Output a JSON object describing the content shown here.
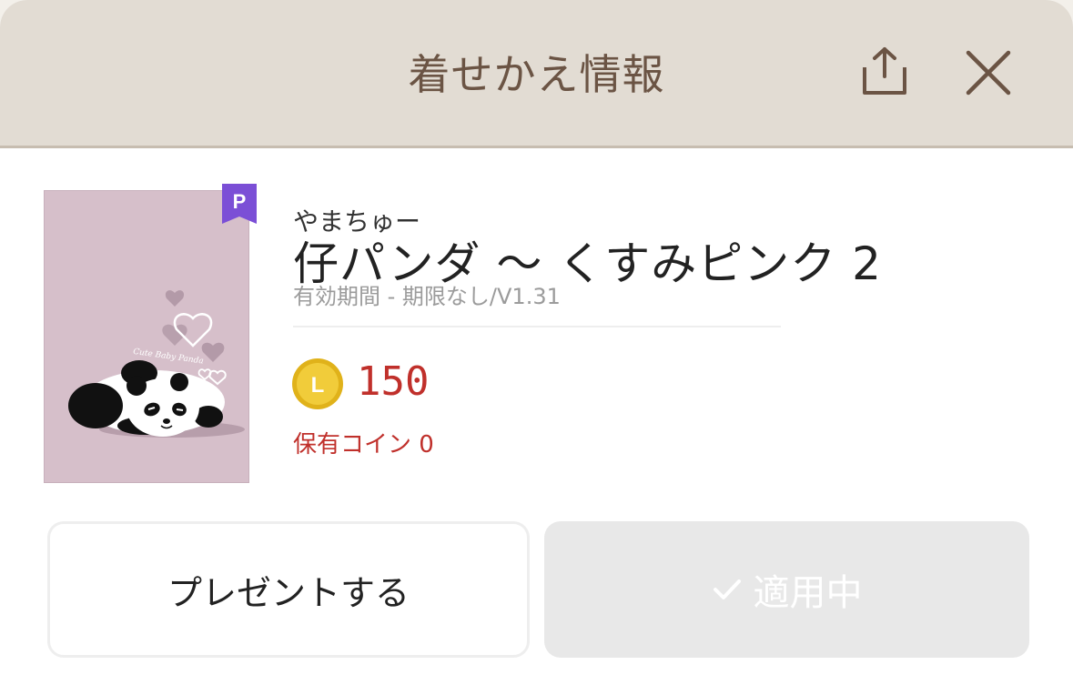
{
  "header": {
    "title": "着せかえ情報",
    "share_icon": "share-icon",
    "close_icon": "close-icon"
  },
  "theme": {
    "premium_badge": "P",
    "artist": "やまちゅー",
    "title": "仔パンダ 〜 くすみピンク 2",
    "meta": "有効期間 - 期限なし/V1.31",
    "thumbnail_caption": "Cute Baby Panda",
    "thumbnail_bg": "#d6bfca"
  },
  "price": {
    "coin_letter": "L",
    "amount": "150",
    "owned": "保有コイン 0",
    "color": "#c0302b"
  },
  "actions": {
    "present_label": "プレゼントする",
    "applied_label": "適用中"
  }
}
